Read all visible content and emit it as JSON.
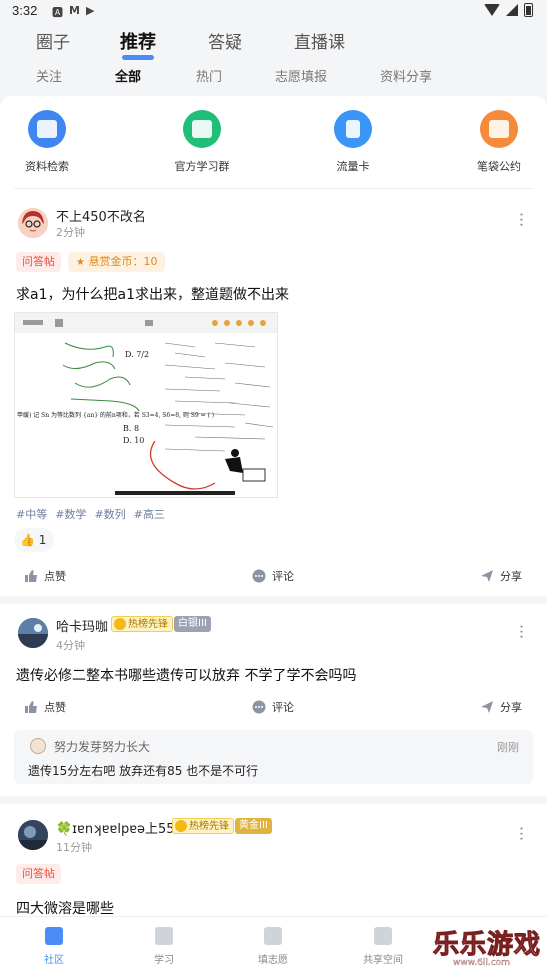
{
  "status": {
    "time": "3:32"
  },
  "top_tabs": [
    "圈子",
    "推荐",
    "答疑",
    "直播课"
  ],
  "sub_tabs": [
    "关注",
    "全部",
    "热门",
    "志愿填报",
    "资料分享"
  ],
  "shortcuts": [
    "资料检索",
    "官方学习群",
    "流量卡",
    "笔袋公约"
  ],
  "post1": {
    "user": "不上450不改名",
    "time": "2分钟",
    "tag": "问答帖",
    "reward": "悬赏金币：10",
    "title": "求a1，为什么把a1求出来，整道题做不出来",
    "hashtags": [
      "#中等",
      "#数学",
      "#数列",
      "#高三"
    ],
    "like_count": "1",
    "actions": {
      "like": "点赞",
      "comment": "评论",
      "share": "分享"
    },
    "image": {
      "problem_text": "甲缓) 记 Sn 为等比数列 {an} 的前n项和，若 S3=4, S6=8, 则 S9 = (     )",
      "options": [
        "B. 8",
        "D. 10"
      ],
      "fractions": [
        "D. 7/2"
      ]
    }
  },
  "post2": {
    "user": "哈卡玛咖",
    "badge1": "热榜先锋",
    "badge2": "白银III",
    "time": "4分钟",
    "title": "遗传必修二整本书哪些遗传可以放弃 不学了学不会吗吗",
    "actions": {
      "like": "点赞",
      "comment": "评论",
      "share": "分享"
    },
    "comment": {
      "user": "努力发芽努力长大",
      "time": "刚刚",
      "text": "遗传15分左右吧 放弃还有85 也不是不可行"
    }
  },
  "post3": {
    "user": "🍀ɪɐnʞɐɐlpɐə上550",
    "badge1": "热榜先锋",
    "badge2": "黄金III",
    "time": "11分钟",
    "tag": "问答帖",
    "title": "四大微溶是哪些"
  },
  "bottom_nav": [
    "社区",
    "学习",
    "填志愿",
    "共享空间"
  ],
  "watermark": {
    "title": "乐乐游戏",
    "url": "www.6ll.com"
  },
  "colors": {
    "accent": "#4a8df8",
    "red_tag": "#e5533c",
    "orange_tag": "#e38a1b"
  }
}
